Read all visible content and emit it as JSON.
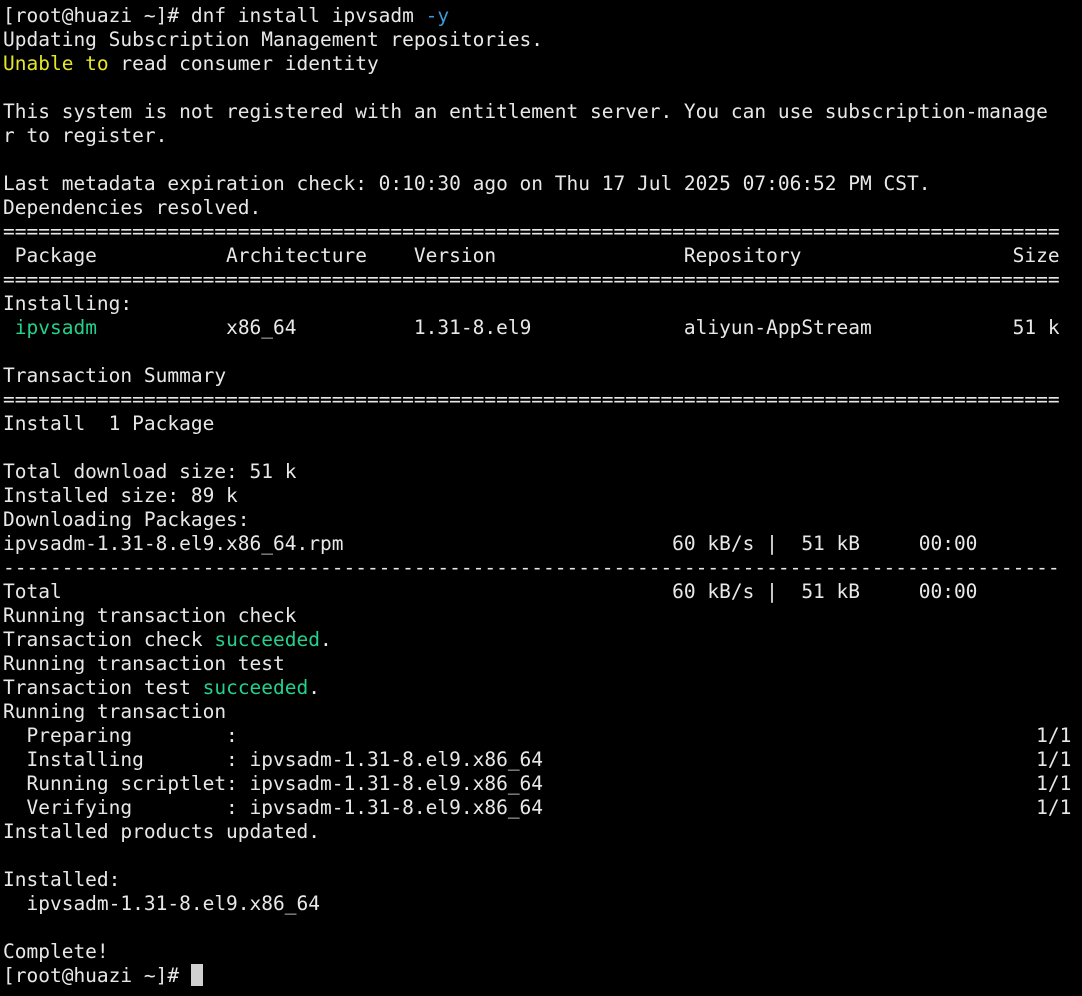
{
  "colors": {
    "default": "#e8e8e8",
    "yellow": "#e5e52a",
    "green": "#23d18b",
    "cyan": "#3b9bd6",
    "background": "#000000",
    "cursor": "#d0d0d0"
  },
  "lines": [
    [
      {
        "text": "[root@huazi ~]# dnf install ipvsadm "
      },
      {
        "text": "-y",
        "color": "cyan"
      }
    ],
    [
      {
        "text": "Updating Subscription Management repositories."
      }
    ],
    [
      {
        "text": "Unable to",
        "color": "yellow"
      },
      {
        "text": " read consumer identity"
      }
    ],
    [
      {
        "text": ""
      }
    ],
    [
      {
        "text": "This system is not registered with an entitlement server. You can use subscription-manage"
      }
    ],
    [
      {
        "text": "r to register."
      }
    ],
    [
      {
        "text": ""
      }
    ],
    [
      {
        "text": "Last metadata expiration check: 0:10:30 ago on Thu 17 Jul 2025 07:06:52 PM CST."
      }
    ],
    [
      {
        "text": "Dependencies resolved."
      }
    ],
    [
      {
        "text": "=========================================================================================="
      }
    ],
    [
      {
        "text": " Package           Architecture    Version                Repository                  Size"
      }
    ],
    [
      {
        "text": "=========================================================================================="
      }
    ],
    [
      {
        "text": "Installing:"
      }
    ],
    [
      {
        "text": " "
      },
      {
        "text": "ipvsadm",
        "color": "green"
      },
      {
        "text": "           x86_64          1.31-8.el9             aliyun-AppStream            51 k"
      }
    ],
    [
      {
        "text": ""
      }
    ],
    [
      {
        "text": "Transaction Summary"
      }
    ],
    [
      {
        "text": "=========================================================================================="
      }
    ],
    [
      {
        "text": "Install  1 Package"
      }
    ],
    [
      {
        "text": ""
      }
    ],
    [
      {
        "text": "Total download size: 51 k"
      }
    ],
    [
      {
        "text": "Installed size: 89 k"
      }
    ],
    [
      {
        "text": "Downloading Packages:"
      }
    ],
    [
      {
        "text": "ipvsadm-1.31-8.el9.x86_64.rpm                            60 kB/s |  51 kB     00:00"
      }
    ],
    [
      {
        "text": "------------------------------------------------------------------------------------------"
      }
    ],
    [
      {
        "text": "Total                                                    60 kB/s |  51 kB     00:00"
      }
    ],
    [
      {
        "text": "Running transaction check"
      }
    ],
    [
      {
        "text": "Transaction check "
      },
      {
        "text": "succeeded",
        "color": "green"
      },
      {
        "text": "."
      }
    ],
    [
      {
        "text": "Running transaction test"
      }
    ],
    [
      {
        "text": "Transaction test "
      },
      {
        "text": "succeeded",
        "color": "green"
      },
      {
        "text": "."
      }
    ],
    [
      {
        "text": "Running transaction"
      }
    ],
    [
      {
        "text": "  Preparing        :                                                                    1/1"
      }
    ],
    [
      {
        "text": "  Installing       : ipvsadm-1.31-8.el9.x86_64                                          1/1"
      }
    ],
    [
      {
        "text": "  Running scriptlet: ipvsadm-1.31-8.el9.x86_64                                          1/1"
      }
    ],
    [
      {
        "text": "  Verifying        : ipvsadm-1.31-8.el9.x86_64                                          1/1"
      }
    ],
    [
      {
        "text": "Installed products updated."
      }
    ],
    [
      {
        "text": ""
      }
    ],
    [
      {
        "text": "Installed:"
      }
    ],
    [
      {
        "text": "  ipvsadm-1.31-8.el9.x86_64"
      }
    ],
    [
      {
        "text": ""
      }
    ],
    [
      {
        "text": "Complete!"
      }
    ],
    [
      {
        "text": "[root@huazi ~]# "
      },
      {
        "cursor": true
      }
    ]
  ]
}
